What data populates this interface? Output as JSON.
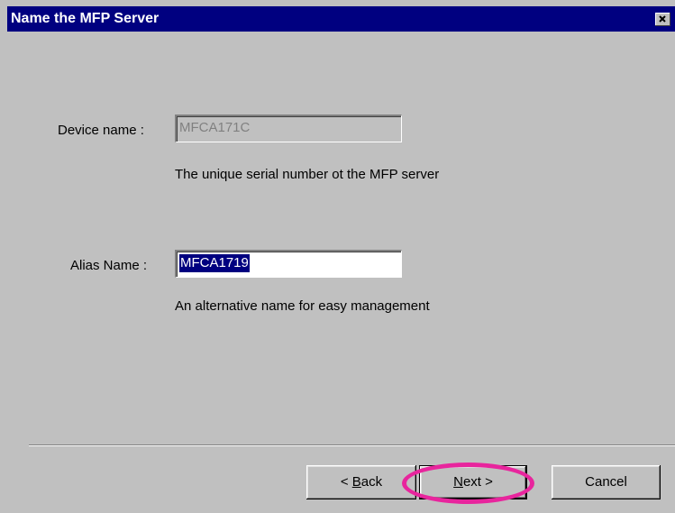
{
  "window": {
    "title": "Name the MFP Server",
    "close_label": "×"
  },
  "device": {
    "label": "Device name :",
    "value": "MFCA171C",
    "description": "The unique serial number ot the MFP server"
  },
  "alias": {
    "label": "Alias Name :",
    "value": "MFCA1719",
    "description": "An alternative name for easy management"
  },
  "buttons": {
    "back_prefix": "< ",
    "back_mnemonic": "B",
    "back_rest": "ack",
    "next_mnemonic": "N",
    "next_rest": "ext >",
    "cancel": "Cancel"
  },
  "colors": {
    "face": "#c0c0c0",
    "titlebar": "#000080",
    "annotation_highlight": "#e8259d"
  },
  "icons": {
    "close": "close-icon"
  }
}
